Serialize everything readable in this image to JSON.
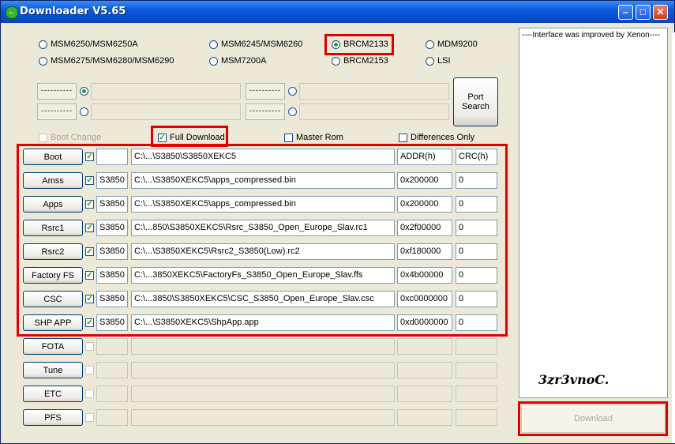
{
  "window": {
    "title": "Downloader V5.65"
  },
  "platforms": [
    {
      "label": "MSM6250/MSM6250A",
      "selected": false
    },
    {
      "label": "MSM6245/MSM6260",
      "selected": false
    },
    {
      "label": "BRCM2133",
      "selected": true
    },
    {
      "label": "MDM9200",
      "selected": false
    },
    {
      "label": "MSM6275/MSM6280/MSM6290",
      "selected": false
    },
    {
      "label": "MSM7200A",
      "selected": false
    },
    {
      "label": "BRCM2153",
      "selected": false
    },
    {
      "label": "LSI",
      "selected": false
    }
  ],
  "ports": {
    "placeholder": "----------",
    "search_label_1": "Port",
    "search_label_2": "Search"
  },
  "options": {
    "boot_change": "Boot Change",
    "full_download": "Full Download",
    "master_rom": "Master Rom",
    "differences_only": "Differences Only"
  },
  "columns": {
    "addr": "ADDR(h)",
    "crc": "CRC(h)"
  },
  "rows": [
    {
      "name": "Boot",
      "checked": true,
      "model": "",
      "path": "C:\\...\\S3850\\S3850XEKC5",
      "addr": "",
      "crc": ""
    },
    {
      "name": "Amss",
      "checked": true,
      "model": "S3850",
      "path": "C:\\...\\S3850XEKC5\\apps_compressed.bin",
      "addr": "0x200000",
      "crc": "0"
    },
    {
      "name": "Apps",
      "checked": true,
      "model": "S3850",
      "path": "C:\\...\\S3850XEKC5\\apps_compressed.bin",
      "addr": "0x200000",
      "crc": "0"
    },
    {
      "name": "Rsrc1",
      "checked": true,
      "model": "S3850",
      "path": "C:\\...850\\S3850XEKC5\\Rsrc_S3850_Open_Europe_Slav.rc1",
      "addr": "0x2f00000",
      "crc": "0"
    },
    {
      "name": "Rsrc2",
      "checked": true,
      "model": "S3850",
      "path": "C:\\...\\S3850XEKC5\\Rsrc2_S3850(Low).rc2",
      "addr": "0xf180000",
      "crc": "0"
    },
    {
      "name": "Factory FS",
      "checked": true,
      "model": "S3850",
      "path": "C:\\...3850XEKC5\\FactoryFs_S3850_Open_Europe_Slav.ffs",
      "addr": "0x4b00000",
      "crc": "0"
    },
    {
      "name": "CSC",
      "checked": true,
      "model": "S3850",
      "path": "C:\\...3850\\S3850XEKC5\\CSC_S3850_Open_Europe_Slav.csc",
      "addr": "0xc0000000",
      "crc": "0"
    },
    {
      "name": "SHP APP",
      "checked": true,
      "model": "S3850",
      "path": "C:\\...\\S3850XEKC5\\ShpApp.app",
      "addr": "0xd0000000",
      "crc": "0"
    },
    {
      "name": "FOTA",
      "checked": false,
      "model": "",
      "path": "",
      "addr": "",
      "crc": ""
    },
    {
      "name": "Tune",
      "checked": false,
      "model": "",
      "path": "",
      "addr": "",
      "crc": ""
    },
    {
      "name": "ETC",
      "checked": false,
      "model": "",
      "path": "",
      "addr": "",
      "crc": ""
    },
    {
      "name": "PFS",
      "checked": false,
      "model": "",
      "path": "",
      "addr": "",
      "crc": ""
    }
  ],
  "log": {
    "line": "----Interface was improved by Xenon----",
    "signature": "3zr3vnoC."
  },
  "download_label": "Download",
  "colors": {
    "titlebar": "#0550D0",
    "highlight": "#E00000",
    "face": "#ECE9D8"
  }
}
